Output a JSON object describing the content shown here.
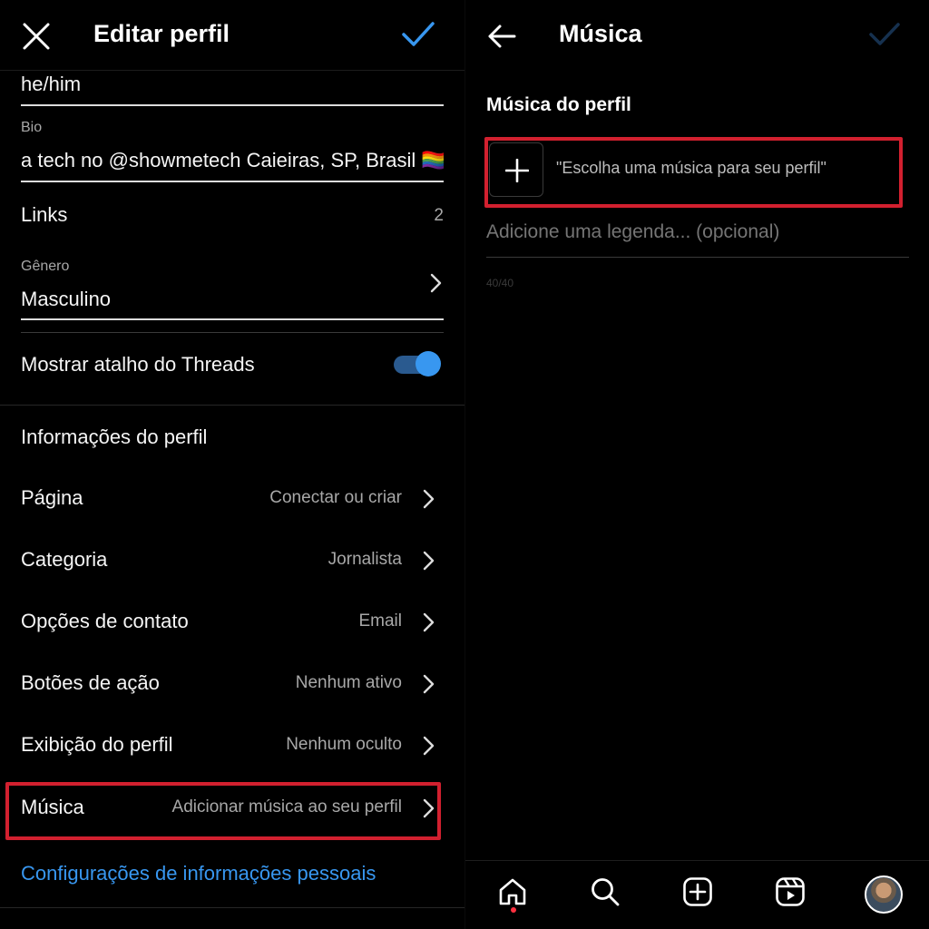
{
  "left": {
    "header": {
      "title": "Editar perfil"
    },
    "pronouns_value": "he/him",
    "bio": {
      "label": "Bio",
      "value": "a tech no @showmetech Caieiras, SP, Brasil 🏳️‍🌈"
    },
    "links": {
      "label": "Links",
      "count": "2"
    },
    "gender": {
      "label": "Gênero",
      "value": "Masculino"
    },
    "threads_toggle": {
      "label": "Mostrar atalho do Threads",
      "state": "on"
    },
    "profile_info_heading": "Informações do perfil",
    "rows": [
      {
        "label": "Página",
        "value": "Conectar ou criar"
      },
      {
        "label": "Categoria",
        "value": "Jornalista"
      },
      {
        "label": "Opções de contato",
        "value": "Email"
      },
      {
        "label": "Botões de ação",
        "value": "Nenhum ativo"
      },
      {
        "label": "Exibição do perfil",
        "value": "Nenhum oculto"
      },
      {
        "label": "Música",
        "value": "Adicionar música ao seu perfil"
      }
    ],
    "personal_settings_link": "Configurações de informações pessoais"
  },
  "right": {
    "header": {
      "title": "Música"
    },
    "section_title": "Música do perfil",
    "music_picker_hint": "\"Escolha uma música para seu perfil\"",
    "caption_placeholder": "Adicione uma legenda... (opcional)",
    "caption_counter": "40/40",
    "bottom_nav": [
      "home-icon",
      "search-icon",
      "create-icon",
      "reels-icon",
      "profile-avatar"
    ]
  },
  "colors": {
    "accent": "#3897f0",
    "highlight_box": "#d2202f",
    "background": "#000000",
    "notification_dot": "#ff3040"
  }
}
